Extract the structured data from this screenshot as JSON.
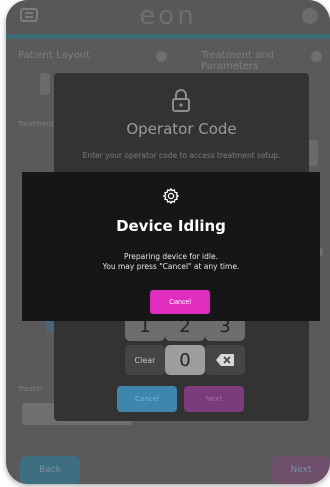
{
  "app": {
    "brand": "eon"
  },
  "background": {
    "left_label": "Patient Layout",
    "right_label": "Treatment and Parameters",
    "side_label": "Treatment",
    "bottom_label": "Treatm",
    "bottom_left_btn": "Back",
    "bottom_right_btn": "Next"
  },
  "operator_modal": {
    "title": "Operator Code",
    "description": "Enter your operator code to access treatment setup.",
    "keypad": {
      "k1": "1",
      "k2": "2",
      "k3": "3",
      "clear": "Clear",
      "k0": "0"
    },
    "cancel_label": "Cancel",
    "next_label": "Next"
  },
  "idle_modal": {
    "title": "Device Idling",
    "line1": "Preparing device for idle.",
    "line2": "You may press \"Cancel\" at any time.",
    "cancel_label": "Cancel"
  },
  "colors": {
    "accent": "#e02cbf",
    "teal": "#3d6e73",
    "overlay": "#161616"
  }
}
